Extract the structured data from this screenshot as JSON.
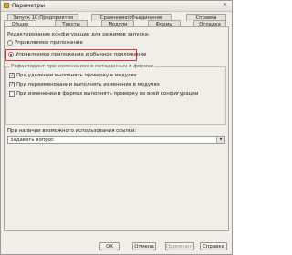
{
  "window": {
    "title": "Параметры",
    "close_glyph": "✕"
  },
  "tabs_back": [
    "Запуск 1С:Предприятия",
    "Сравнение/объединение",
    "Справка"
  ],
  "tabs_front": [
    "Общие",
    "Тексты",
    "Модули",
    "Формы",
    "Отладка"
  ],
  "active_tab": "Общие",
  "general": {
    "launch_heading": "Редактирование конфигурации для режимов запуска:",
    "radio_managed": "Управляемое приложение",
    "radio_managed_ordinary": "Управляемое приложение и обычное приложение",
    "selected_radio": "radio_managed_ordinary",
    "refactoring_group": "Рефакторинг при изменениях в метаданных и формах",
    "check_delete": "При удалении выполнять проверку в модулях",
    "check_rename": "При переименовании выполнять изменения в модулях",
    "check_forms": "При изменении в формах выполнять проверку во всей конфигурации",
    "check_delete_state": true,
    "check_rename_state": true,
    "check_forms_state": false,
    "ref_heading": "При наличии возможного использования ссылки:",
    "ref_select_value": "Задавать вопрос"
  },
  "buttons": {
    "ok": "ОК",
    "cancel": "Отмена",
    "apply": "Применить",
    "help": "Справка"
  },
  "colors": {
    "highlight": "#e03030",
    "window_bg": "#f0eee6"
  },
  "icons": {
    "checkmark": "✓",
    "dropdown": "▼"
  }
}
